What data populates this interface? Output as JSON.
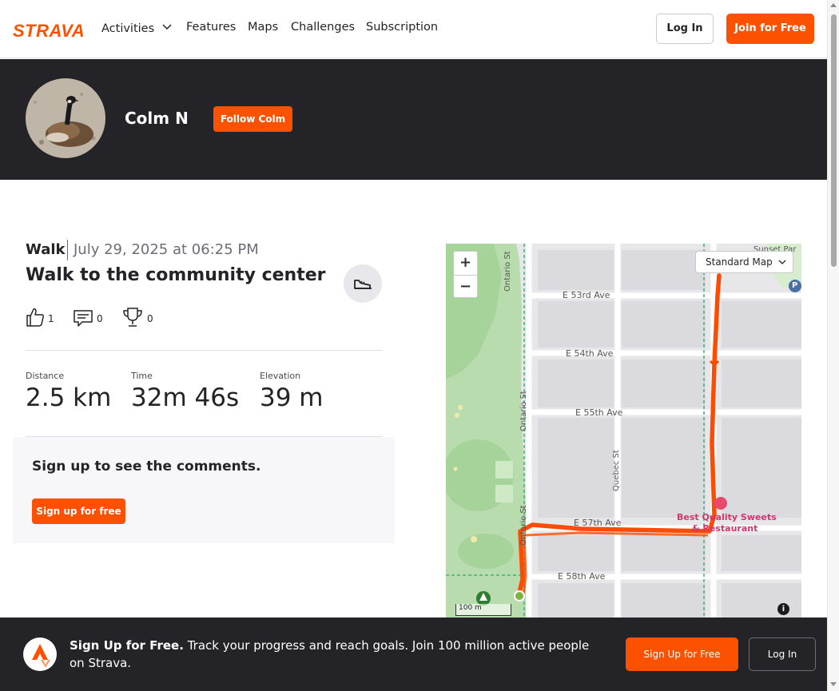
{
  "nav": {
    "logo": "STRAVA",
    "items": [
      "Activities",
      "Features",
      "Maps",
      "Challenges",
      "Subscription"
    ],
    "login_label": "Log In",
    "join_label": "Join for Free"
  },
  "profile": {
    "name": "Colm N",
    "follow_label": "Follow Colm"
  },
  "activity": {
    "type": "Walk",
    "date": "July 29, 2025 at 06:25 PM",
    "title": "Walk to the community center",
    "kudos": "1",
    "comments": "0",
    "achievements": "0",
    "stats": [
      {
        "label": "Distance",
        "value": "2.5 km"
      },
      {
        "label": "Time",
        "value": "32m 46s"
      },
      {
        "label": "Elevation",
        "value": "39 m"
      }
    ]
  },
  "comments": {
    "heading": "Sign up to see the comments.",
    "signup_label": "Sign up for free"
  },
  "map": {
    "style_label": "Standard Map",
    "zoom_in": "+",
    "zoom_out": "−",
    "scale_label": "100 m",
    "info": "i",
    "streets": {
      "e53": "E 53rd Ave",
      "e54": "E 54th Ave",
      "e55": "E 55th Ave",
      "e57": "E 57th Ave",
      "e58": "E 58th Ave",
      "ontario": "Ontario St",
      "quebec": "Quebec St",
      "sunset": "Sunset Par"
    },
    "poi": "Best Quality Sweets & Restaurant",
    "poi_line1": "Best Quality Sweets",
    "poi_line2": "& Restaurant",
    "parking": "P",
    "route_color": "#fc4c02"
  },
  "cta": {
    "bold": "Sign Up for Free.",
    "text": "Track your progress and reach goals. Join 100 million active people on Strava.",
    "signup_label": "Sign Up for Free",
    "login_label": "Log In"
  },
  "colors": {
    "brand": "#fc5200",
    "dark": "#242428"
  }
}
